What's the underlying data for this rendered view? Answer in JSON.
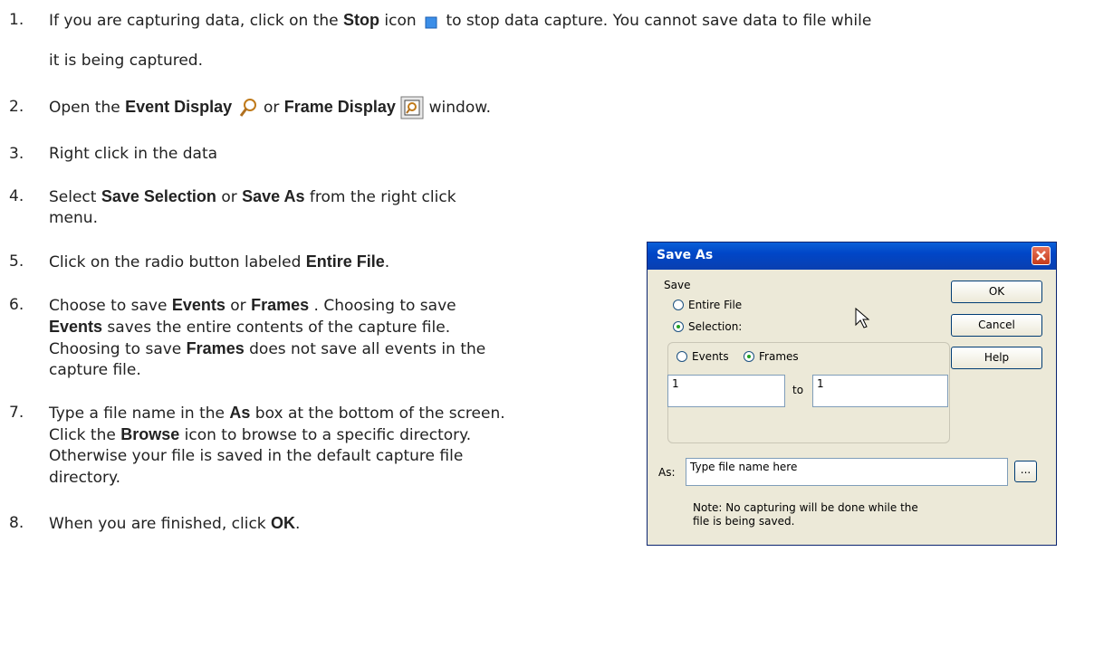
{
  "steps": [
    {
      "num": "1.",
      "parts": [
        "If you are capturing data, click on the ",
        "Stop",
        " icon ",
        " to stop data capture. You cannot save data to file while"
      ],
      "line2": "it is being captured.",
      "icon": "stop-icon"
    },
    {
      "num": "2.",
      "parts": [
        "Open the ",
        "Event Display",
        " or ",
        "Frame Display",
        " window."
      ]
    },
    {
      "num": "3.",
      "text": "Right click in the data"
    },
    {
      "num": "4.",
      "parts": [
        "Select ",
        "Save Selection",
        " or ",
        "Save As",
        " from the right click"
      ],
      "line2": "menu."
    },
    {
      "num": "5.",
      "parts": [
        "Click on the radio button labeled ",
        "Entire File",
        "."
      ]
    },
    {
      "num": "6.",
      "l1": [
        "Choose to save ",
        "Events",
        " or ",
        "Frames",
        " . Choosing to save"
      ],
      "l2": [
        "Events",
        " saves the entire contents of the capture file."
      ],
      "l3": [
        "Choosing to save ",
        "Frames",
        " does not save all events in the"
      ],
      "l4": "capture file."
    },
    {
      "num": "7.",
      "l1": [
        "Type a file name in the ",
        "As",
        " box at the bottom of the screen."
      ],
      "l2": [
        "Click the ",
        "Browse",
        " icon to browse to a specific directory."
      ],
      "l3": "Otherwise your file is saved in the default capture file",
      "l4": "directory."
    },
    {
      "num": "8.",
      "parts": [
        "When you are finished, click ",
        "OK",
        "."
      ]
    }
  ],
  "dialog": {
    "title": "Save As",
    "save_group": "Save",
    "entire_file": "Entire File",
    "selection": "Selection:",
    "events": "Events",
    "frames": "Frames",
    "from_value": "1",
    "to_label": "to",
    "to_value": "1",
    "as_label": "As:",
    "as_value": "Type file name here",
    "browse": "...",
    "note1": "Note: No capturing will be done while the",
    "note2": "file is being saved.",
    "ok": "OK",
    "cancel": "Cancel",
    "help": "Help"
  },
  "colors": {
    "title_bar": "#0046c7",
    "dialog_bg": "#ece9d8",
    "close_red": "#c53a19"
  }
}
